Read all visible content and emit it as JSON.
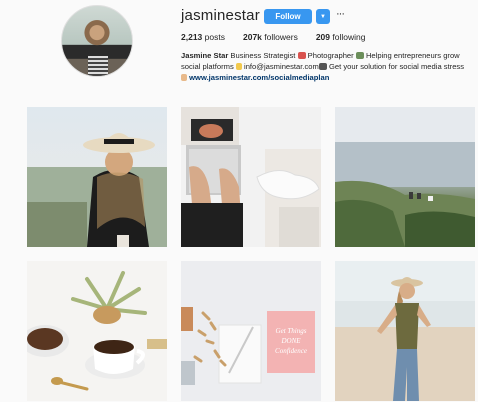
{
  "profile": {
    "username": "jasminestar",
    "follow_label": "Follow",
    "dropdown_glyph": "▼",
    "more_glyph": "···",
    "posts_count": "2,213",
    "posts_label": "posts",
    "followers_count": "207k",
    "followers_label": "followers",
    "following_count": "209",
    "following_label": "following",
    "display_name": "Jasmine Star",
    "bio_part1": "Business Strategist",
    "bio_part2": "Photographer",
    "bio_part3": "Helping entrepreneurs grow social platforms",
    "bio_email": "info@jasminestar.com",
    "bio_part4": "Get your solution for social media stress",
    "bio_link": "www.jasminestar.com/socialmediaplan"
  },
  "colors": {
    "follow_blue": "#3897f0",
    "link_blue": "#003569",
    "background": "#fafafa"
  },
  "posts": [
    {
      "subject": "woman-in-hat-outdoors"
    },
    {
      "subject": "laptop-desk-flatlay"
    },
    {
      "subject": "ocean-cliffside"
    },
    {
      "subject": "coffee-plant-flatlay"
    },
    {
      "subject": "pink-notebook-desk-flatlay"
    },
    {
      "subject": "woman-on-beach"
    }
  ]
}
